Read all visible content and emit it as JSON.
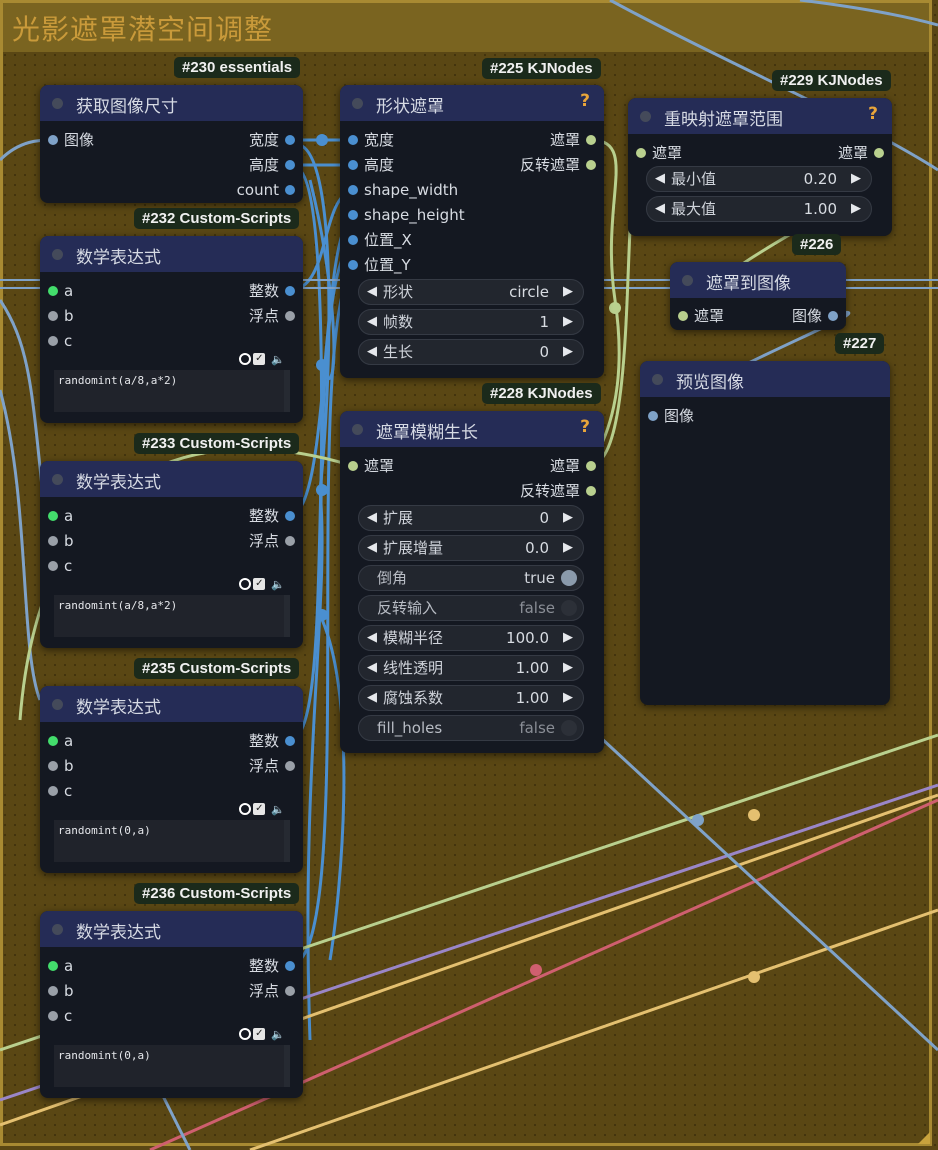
{
  "group": {
    "title": "光影遮罩潜空间调整"
  },
  "colors": {
    "image_wire": "#4a8fd0",
    "mask_wire": "#b9d08e",
    "int_wire": "#4a8fd0"
  },
  "nodes": {
    "n230": {
      "badge": "#230 essentials",
      "title": "获取图像尺寸",
      "inputs": [
        "图像"
      ],
      "outputs": [
        "宽度",
        "高度",
        "count"
      ]
    },
    "n225": {
      "badge": "#225 KJNodes",
      "title": "形状遮罩",
      "help": "?",
      "inputs": [
        "宽度",
        "高度",
        "shape_width",
        "shape_height",
        "位置_X",
        "位置_Y"
      ],
      "outputs": [
        "遮罩",
        "反转遮罩"
      ],
      "widgets": [
        {
          "label": "形状",
          "value": "circle"
        },
        {
          "label": "帧数",
          "value": "1"
        },
        {
          "label": "生长",
          "value": "0"
        }
      ]
    },
    "n229": {
      "badge": "#229 KJNodes",
      "title": "重映射遮罩范围",
      "help": "?",
      "inputs": [
        "遮罩"
      ],
      "outputs": [
        "遮罩"
      ],
      "widgets": [
        {
          "label": "最小值",
          "value": "0.20"
        },
        {
          "label": "最大值",
          "value": "1.00"
        }
      ]
    },
    "n226": {
      "badge": "#226",
      "title": "遮罩到图像",
      "inputs": [
        "遮罩"
      ],
      "outputs": [
        "图像"
      ]
    },
    "n227": {
      "badge": "#227",
      "title": "预览图像",
      "inputs": [
        "图像"
      ]
    },
    "n228": {
      "badge": "#228 KJNodes",
      "title": "遮罩模糊生长",
      "help": "?",
      "inputs": [
        "遮罩"
      ],
      "outputs": [
        "遮罩",
        "反转遮罩"
      ],
      "widgets": [
        {
          "label": "扩展",
          "value": "0"
        },
        {
          "label": "扩展增量",
          "value": "0.0"
        },
        {
          "label": "倒角",
          "value": "true",
          "toggle": true,
          "on": true
        },
        {
          "label": "反转输入",
          "value": "false",
          "toggle": true,
          "on": false
        },
        {
          "label": "模糊半径",
          "value": "100.0"
        },
        {
          "label": "线性透明",
          "value": "1.00"
        },
        {
          "label": "腐蚀系数",
          "value": "1.00"
        },
        {
          "label": "fill_holes",
          "value": "false",
          "toggle": true,
          "on": false
        }
      ]
    },
    "n232": {
      "badge": "#232 Custom-Scripts",
      "title": "数学表达式",
      "inputs": [
        "a",
        "b",
        "c"
      ],
      "outputs": [
        "整数",
        "浮点"
      ],
      "expression": "randomint(a/8,a*2)"
    },
    "n233": {
      "badge": "#233 Custom-Scripts",
      "title": "数学表达式",
      "inputs": [
        "a",
        "b",
        "c"
      ],
      "outputs": [
        "整数",
        "浮点"
      ],
      "expression": "randomint(a/8,a*2)"
    },
    "n235": {
      "badge": "#235 Custom-Scripts",
      "title": "数学表达式",
      "inputs": [
        "a",
        "b",
        "c"
      ],
      "outputs": [
        "整数",
        "浮点"
      ],
      "expression": "randomint(0,a)"
    },
    "n236": {
      "badge": "#236 Custom-Scripts",
      "title": "数学表达式",
      "inputs": [
        "a",
        "b",
        "c"
      ],
      "outputs": [
        "整数",
        "浮点"
      ],
      "expression": "randomint(0,a)"
    }
  },
  "icons": [
    "ring-icon",
    "checkbox-icon",
    "speaker-icon",
    "help-icon",
    "arrow-left-icon",
    "arrow-right-icon",
    "resize-corner-icon"
  ]
}
